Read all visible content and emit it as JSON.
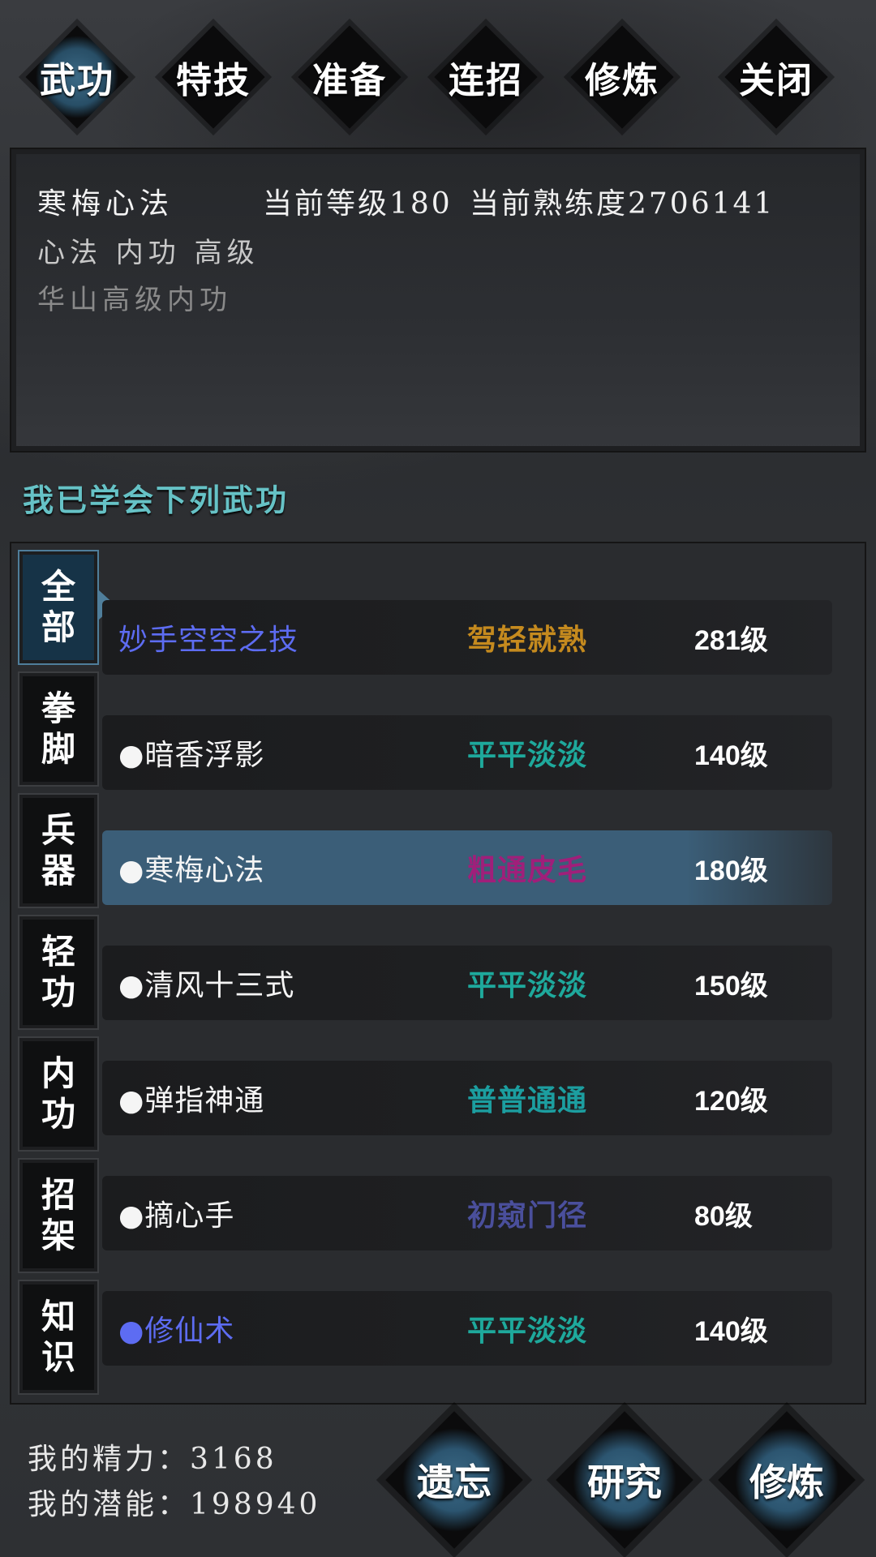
{
  "top_tabs": [
    {
      "label": "武功",
      "active": true
    },
    {
      "label": "特技",
      "active": false
    },
    {
      "label": "准备",
      "active": false
    },
    {
      "label": "连招",
      "active": false
    },
    {
      "label": "修炼",
      "active": false
    },
    {
      "label": "关闭",
      "active": false
    }
  ],
  "info": {
    "name": "寒梅心法",
    "level_text": "当前等级180",
    "proficiency_text": "当前熟练度2706141",
    "type": "心法 内功 高级",
    "desc": "华山高级内功"
  },
  "section_title": "我已学会下列武功",
  "categories": [
    {
      "label_top": "全",
      "label_bottom": "部",
      "active": true
    },
    {
      "label_top": "拳",
      "label_bottom": "脚",
      "active": false
    },
    {
      "label_top": "兵",
      "label_bottom": "器",
      "active": false
    },
    {
      "label_top": "轻",
      "label_bottom": "功",
      "active": false
    },
    {
      "label_top": "内",
      "label_bottom": "功",
      "active": false
    },
    {
      "label_top": "招",
      "label_bottom": "架",
      "active": false
    },
    {
      "label_top": "知",
      "label_bottom": "识",
      "active": false
    }
  ],
  "skills": [
    {
      "name": "妙手空空之技",
      "grade": "驾轻就熟",
      "level": "281级",
      "name_color": "#5d6cf2",
      "grade_color": "#c58a1e"
    },
    {
      "name": "●暗香浮影",
      "grade": "平平淡淡",
      "level": "140级",
      "name_color": "#f5f5f5",
      "grade_color": "#1ea99c"
    },
    {
      "name": "●寒梅心法",
      "grade": "粗通皮毛",
      "level": "180级",
      "name_color": "#f5f5f5",
      "grade_color": "#a01f7a",
      "selected": true
    },
    {
      "name": "●清风十三式",
      "grade": "平平淡淡",
      "level": "150级",
      "name_color": "#f5f5f5",
      "grade_color": "#1ea99c"
    },
    {
      "name": "●弹指神通",
      "grade": "普普通通",
      "level": "120级",
      "name_color": "#f5f5f5",
      "grade_color": "#1c9ea0"
    },
    {
      "name": "●摘心手",
      "grade": "初窥门径",
      "level": "80级",
      "name_color": "#f5f5f5",
      "grade_color": "#4a4f9c"
    },
    {
      "name": "●修仙术",
      "grade": "平平淡淡",
      "level": "140级",
      "name_color": "#5d6cf2",
      "grade_color": "#1ea99c"
    }
  ],
  "stats": {
    "energy": "我的精力：3168",
    "potential": "我的潜能：198940"
  },
  "bottom_buttons": [
    {
      "label": "遗忘"
    },
    {
      "label": "研究"
    },
    {
      "label": "修炼"
    }
  ]
}
